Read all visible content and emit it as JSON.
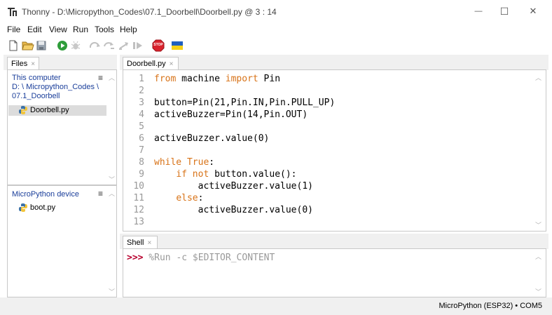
{
  "window": {
    "title": "Thonny  -  D:\\Micropython_Codes\\07.1_Doorbell\\Doorbell.py  @  3 : 14",
    "minimize_glyph": "—",
    "maximize_glyph": "☐",
    "close_glyph": "✕"
  },
  "menu": [
    "File",
    "Edit",
    "View",
    "Run",
    "Tools",
    "Help"
  ],
  "toolbar": {
    "icons": [
      "new-file-icon",
      "open-folder-icon",
      "save-icon",
      "run-icon",
      "debug-icon",
      "step-over-icon",
      "step-into-icon",
      "step-out-icon",
      "resume-icon",
      "stop-icon",
      "ukraine-flag-icon"
    ],
    "stop_label": "STOP"
  },
  "files_panel": {
    "tab_label": "Files",
    "close_glyph": "×",
    "this_computer": {
      "heading": "This computer",
      "path_line1": "D: \\ Micropython_Codes \\",
      "path_line2": "07.1_Doorbell",
      "menu_glyph": "≡",
      "files": [
        "Doorbell.py"
      ]
    },
    "device": {
      "heading": "MicroPython device",
      "menu_glyph": "≡",
      "files": [
        "boot.py"
      ]
    }
  },
  "editor": {
    "tab_label": "Doorbell.py",
    "close_glyph": "×",
    "line_numbers": [
      "1",
      "2",
      "3",
      "4",
      "5",
      "6",
      "7",
      "8",
      "9",
      "10",
      "11",
      "12",
      "13"
    ],
    "lines": [
      {
        "pre": "",
        "kw": "from",
        "rest": " machine ",
        "kw2": "import",
        "rest2": " Pin"
      },
      {
        "pre": "",
        "kw": "",
        "rest": "",
        "kw2": "",
        "rest2": ""
      },
      {
        "pre": "button=Pin(21,Pin.IN,Pin.PULL_UP)",
        "kw": "",
        "rest": "",
        "kw2": "",
        "rest2": ""
      },
      {
        "pre": "activeBuzzer=Pin(14,Pin.OUT)",
        "kw": "",
        "rest": "",
        "kw2": "",
        "rest2": ""
      },
      {
        "pre": "",
        "kw": "",
        "rest": "",
        "kw2": "",
        "rest2": ""
      },
      {
        "pre": "activeBuzzer.value(0)",
        "kw": "",
        "rest": "",
        "kw2": "",
        "rest2": ""
      },
      {
        "pre": "",
        "kw": "",
        "rest": "",
        "kw2": "",
        "rest2": ""
      },
      {
        "pre": "",
        "kw": "while",
        "rest": " ",
        "kw2": "True",
        "rest2": ":"
      },
      {
        "pre": "    ",
        "kw": "if",
        "rest": " ",
        "kw2": "not",
        "rest2": " button.value():"
      },
      {
        "pre": "        activeBuzzer.value(1)",
        "kw": "",
        "rest": "",
        "kw2": "",
        "rest2": ""
      },
      {
        "pre": "    ",
        "kw": "else",
        "rest": ":",
        "kw2": "",
        "rest2": ""
      },
      {
        "pre": "        activeBuzzer.value(0)",
        "kw": "",
        "rest": "",
        "kw2": "",
        "rest2": ""
      },
      {
        "pre": "",
        "kw": "",
        "rest": "",
        "kw2": "",
        "rest2": ""
      }
    ]
  },
  "shell": {
    "tab_label": "Shell",
    "close_glyph": "×",
    "prompt": ">>>",
    "command": " %Run -c $EDITOR_CONTENT"
  },
  "status": {
    "interpreter": "MicroPython (ESP32)  •  COM5"
  },
  "colors": {
    "keyword": "#d87318",
    "prompt": "#b8002e",
    "heading_blue": "#1a3e9a",
    "selected_file_bg": "#dcdcdc"
  }
}
